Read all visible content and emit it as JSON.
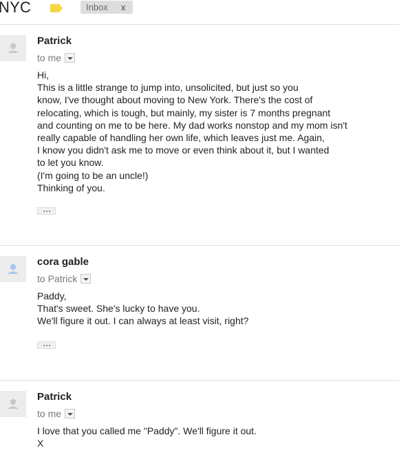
{
  "header": {
    "subject": "NYC",
    "label_color": "#f7d545",
    "tag_icon": "label-tag-icon",
    "inbox_chip": {
      "label": "Inbox",
      "close": "x"
    }
  },
  "messages": [
    {
      "sender": "Patrick",
      "recipient": "to me",
      "avatar_icon": "person-icon",
      "avatar_color": "#c8c8c8",
      "body": [
        "Hi,",
        "This is a little strange to jump into, unsolicited, but just so you",
        "know, I've thought about moving to New York. There's the cost of",
        "relocating, which is tough, but mainly, my sister is 7 months pregnant",
        "and counting on me to be here. My dad works nonstop and my mom isn't",
        "really capable of handling her own life, which leaves just me. Again,",
        "I know you didn't ask me to move or even think about it, but I wanted",
        "to let you know.",
        "(I'm going to be an uncle!)",
        "Thinking of you."
      ],
      "show_trimmed": true
    },
    {
      "sender": "cora gable",
      "recipient": "to Patrick",
      "avatar_icon": "person-icon",
      "avatar_color": "#a9c2f0",
      "body": [
        "Paddy,",
        "That's sweet. She's lucky to have you.",
        "We'll figure it out. I can always at least visit, right?"
      ],
      "show_trimmed": true
    },
    {
      "sender": "Patrick",
      "recipient": "to me",
      "avatar_icon": "person-icon",
      "avatar_color": "#c8c8c8",
      "body": [
        "I love that you called me \"Paddy\". We'll figure it out.",
        "X"
      ],
      "show_trimmed": false
    }
  ]
}
